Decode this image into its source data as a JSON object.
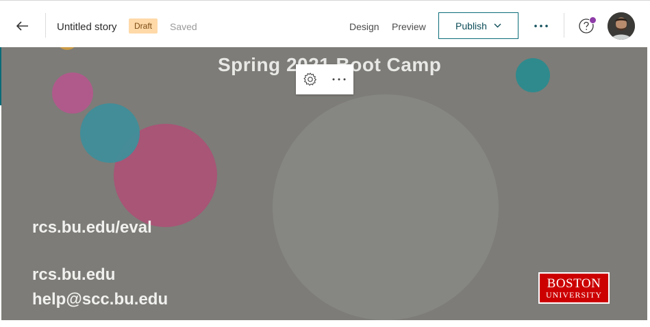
{
  "header": {
    "title": "Untitled story",
    "status_badge": "Draft",
    "save_status": "Saved",
    "nav": {
      "design": "Design",
      "preview": "Preview"
    },
    "publish_label": "Publish",
    "icons": {
      "back": "arrow-left-icon",
      "more": "more-horizontal-icon",
      "help": "question-circle-icon",
      "publish_chevron": "chevron-down-icon"
    },
    "colors": {
      "badge_bg": "#ffd9a8",
      "accent": "#0b6b78",
      "notification_dot": "#8e3ca8"
    }
  },
  "slide": {
    "subtitle": "Spring 2021 Boot Camp",
    "eval_link": "rcs.bu.edu/eval",
    "site": "rcs.bu.edu",
    "email": "help@scc.bu.edu",
    "logo": {
      "line1": "BOSTON",
      "line2": "UNIVERSITY",
      "color": "#cc0000"
    },
    "background_color": "#7d7c78",
    "toolbar": {
      "settings_icon": "gear-icon",
      "more_icon": "more-horizontal-icon"
    }
  }
}
